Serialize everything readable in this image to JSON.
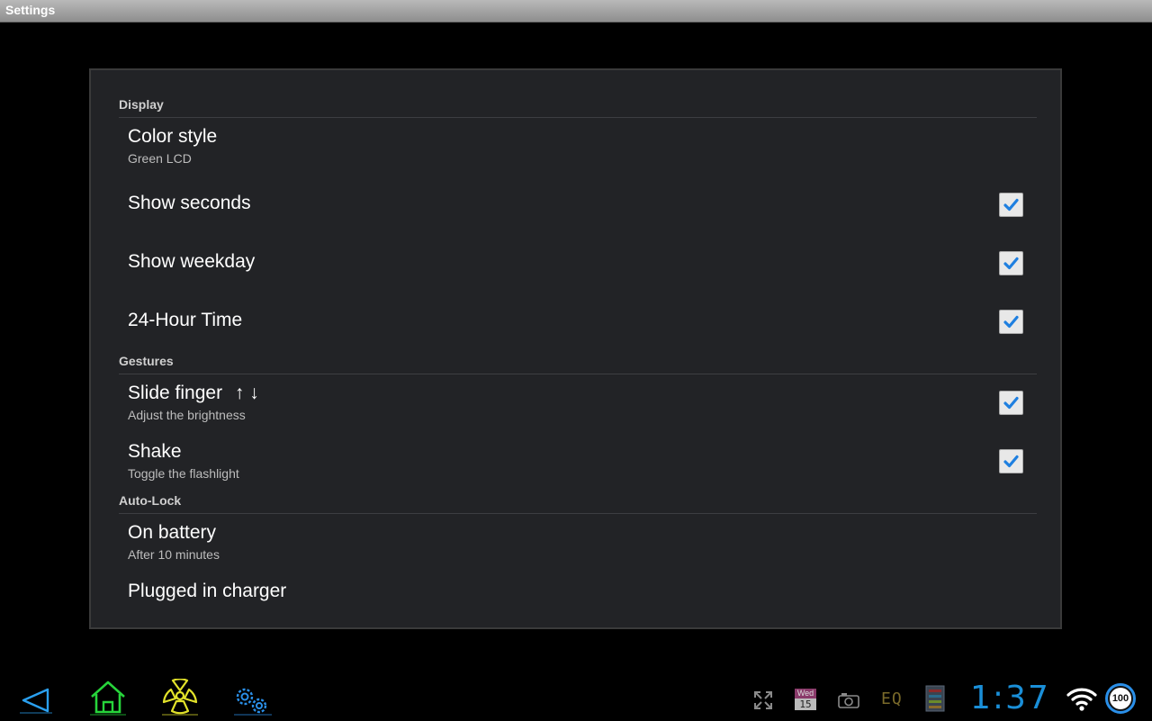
{
  "window": {
    "title": "Settings"
  },
  "sections": [
    {
      "header": "Display"
    },
    {
      "header": "Gestures"
    },
    {
      "header": "Auto-Lock"
    }
  ],
  "prefs": {
    "color_style": {
      "title": "Color style",
      "summary": "Green LCD"
    },
    "show_seconds": {
      "title": "Show seconds",
      "checked": true
    },
    "show_weekday": {
      "title": "Show weekday",
      "checked": true
    },
    "hour24": {
      "title": "24-Hour Time",
      "checked": true
    },
    "slide_finger": {
      "title": "Slide finger",
      "arrows": "↑ ↓",
      "summary": "Adjust the brightness",
      "checked": true
    },
    "shake": {
      "title": "Shake",
      "summary": "Toggle the flashlight",
      "checked": true
    },
    "on_battery": {
      "title": "On battery",
      "summary": "After 10 minutes"
    },
    "plugged": {
      "title": "Plugged in charger"
    }
  },
  "navbar": {
    "icons": [
      "back-icon",
      "home-icon",
      "radiation-icon",
      "settings-gears-icon"
    ],
    "status_icons": [
      "expand-icon",
      "calendar-icon",
      "camera-icon",
      "equalizer-icon",
      "sd-card-icon",
      "wifi-icon",
      "battery-icon"
    ],
    "calendar_day": "Wed",
    "calendar_date": "15",
    "eq_label": "EQ",
    "clock": "1:37",
    "battery_level": "100"
  },
  "colors": {
    "accent_blue": "#1a8fd8",
    "checkmark": "#1e7fe0",
    "home_green": "#27d43b",
    "radiation_yellow": "#e2e22a"
  }
}
